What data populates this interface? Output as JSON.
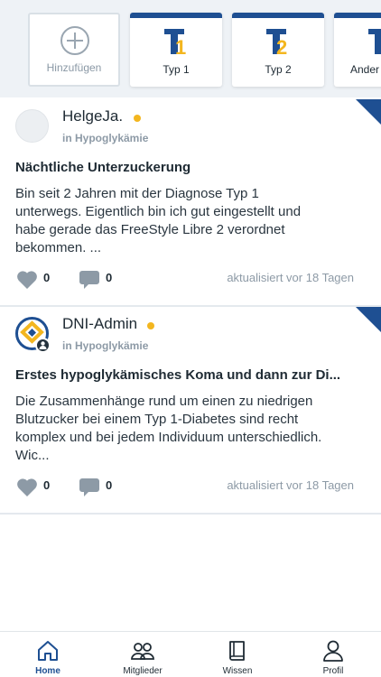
{
  "categories": {
    "add_label": "Hinzufügen",
    "items": [
      {
        "label": "Typ 1",
        "glyph": "T",
        "digit": "1"
      },
      {
        "label": "Typ 2",
        "glyph": "T",
        "digit": "2"
      },
      {
        "label": "Ander",
        "glyph": "T",
        "digit": ""
      }
    ]
  },
  "posts": [
    {
      "author": "HelgeJa.",
      "category": "in Hypoglykämie",
      "title": "Nächtliche Unterzuckerung",
      "excerpt": "Bin seit 2 Jahren mit der Diagnose Typ 1 unterwegs. Eigentlich bin ich gut eingestellt und habe gerade das FreeStyle Libre 2 verordnet bekommen. ...",
      "likes": "0",
      "comments": "0",
      "updated": "aktualisiert vor 18 Tagen"
    },
    {
      "author": "DNI-Admin",
      "category": "in Hypoglykämie",
      "title": "Erstes hypoglykämisches Koma und dann zur Di...",
      "excerpt": "Die Zusammenhänge rund um einen zu niedrigen Blutzucker bei einem Typ 1-Diabetes sind recht komplex und bei jedem Individuum unterschiedlich. Wic...",
      "likes": "0",
      "comments": "0",
      "updated": "aktualisiert vor 18 Tagen"
    }
  ],
  "nav": {
    "home": "Home",
    "members": "Mitglieder",
    "knowledge": "Wissen",
    "profile": "Profil"
  },
  "colors": {
    "brand_blue": "#1e4f92",
    "accent_yellow": "#f3b61f",
    "muted": "#8d9aa6"
  }
}
